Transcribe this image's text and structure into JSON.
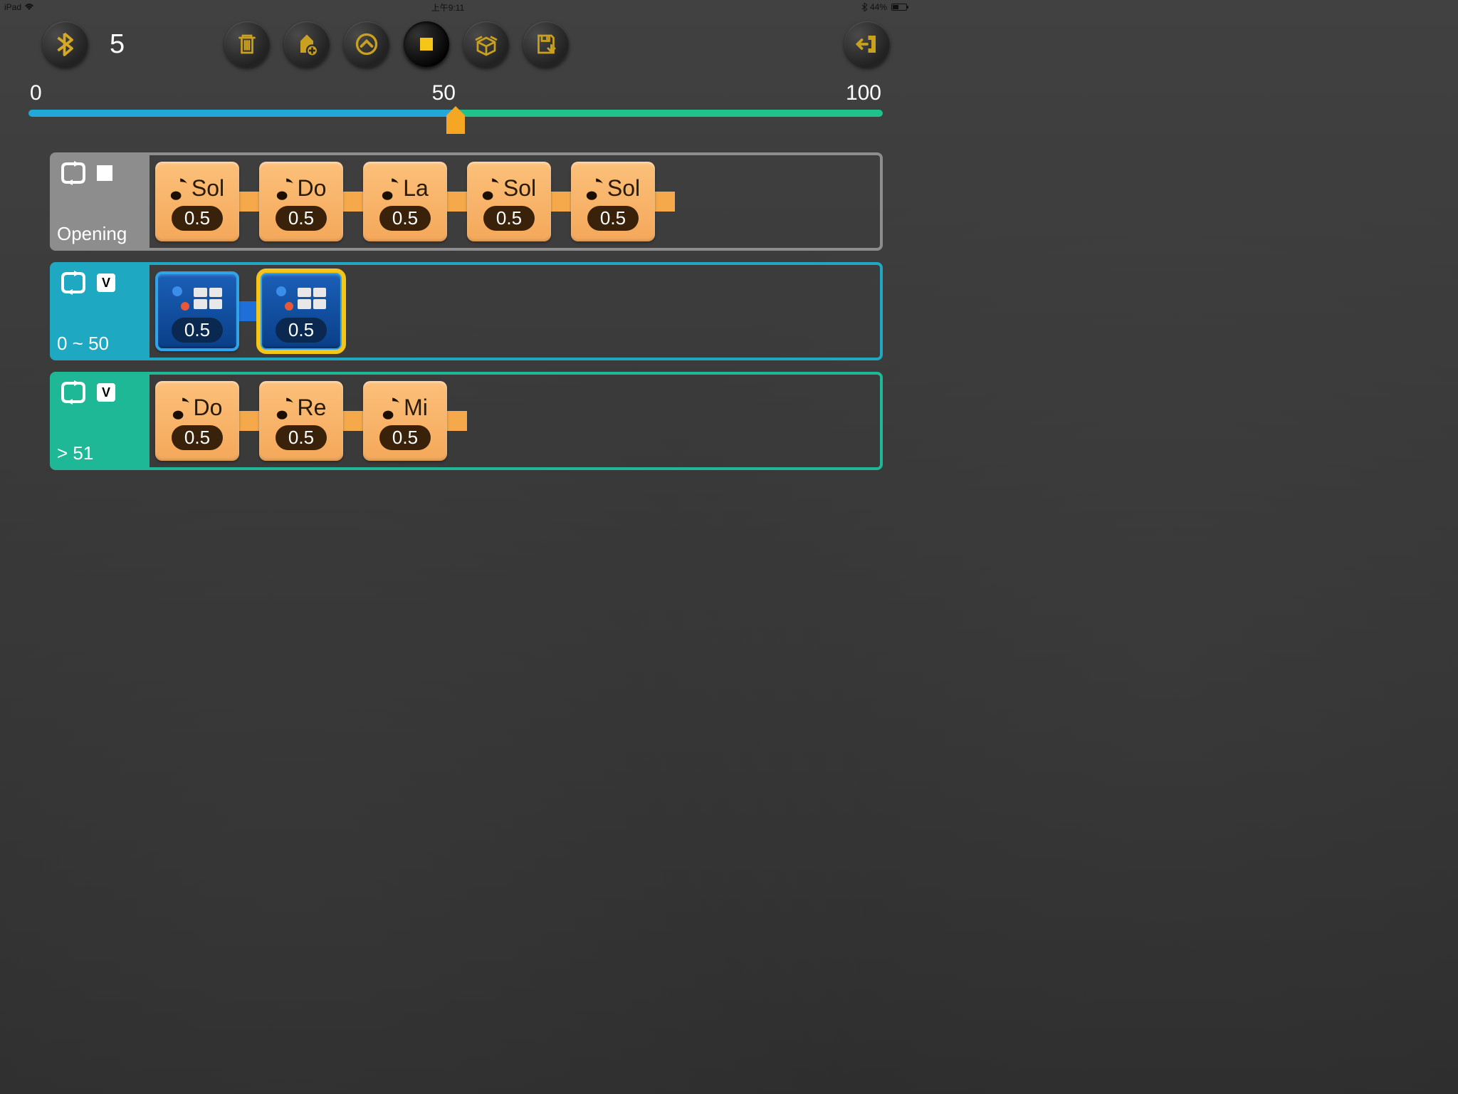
{
  "statusbar": {
    "device": "iPad",
    "time": "上午9:11",
    "battery_pct": "44%"
  },
  "toolbar": {
    "counter": "5"
  },
  "slider": {
    "min": "0",
    "mid": "50",
    "max": "100",
    "position_pct": 50
  },
  "tracks": [
    {
      "color": "gray",
      "label": "Opening",
      "badge": "stop",
      "blocks": [
        {
          "type": "note",
          "note": "Sol",
          "dur": "0.5"
        },
        {
          "type": "note",
          "note": "Do",
          "dur": "0.5"
        },
        {
          "type": "note",
          "note": "La",
          "dur": "0.5"
        },
        {
          "type": "note",
          "note": "Sol",
          "dur": "0.5"
        },
        {
          "type": "note",
          "note": "Sol",
          "dur": "0.5"
        }
      ]
    },
    {
      "color": "teal",
      "label": "0 ~ 50",
      "badge": "v",
      "blocks": [
        {
          "type": "led",
          "dur": "0.5",
          "selected": false
        },
        {
          "type": "led",
          "dur": "0.5",
          "selected": true
        }
      ]
    },
    {
      "color": "green",
      "label": "> 51",
      "badge": "v",
      "blocks": [
        {
          "type": "note",
          "note": "Do",
          "dur": "0.5"
        },
        {
          "type": "note",
          "note": "Re",
          "dur": "0.5"
        },
        {
          "type": "note",
          "note": "Mi",
          "dur": "0.5"
        }
      ]
    }
  ],
  "badge_v": "V"
}
